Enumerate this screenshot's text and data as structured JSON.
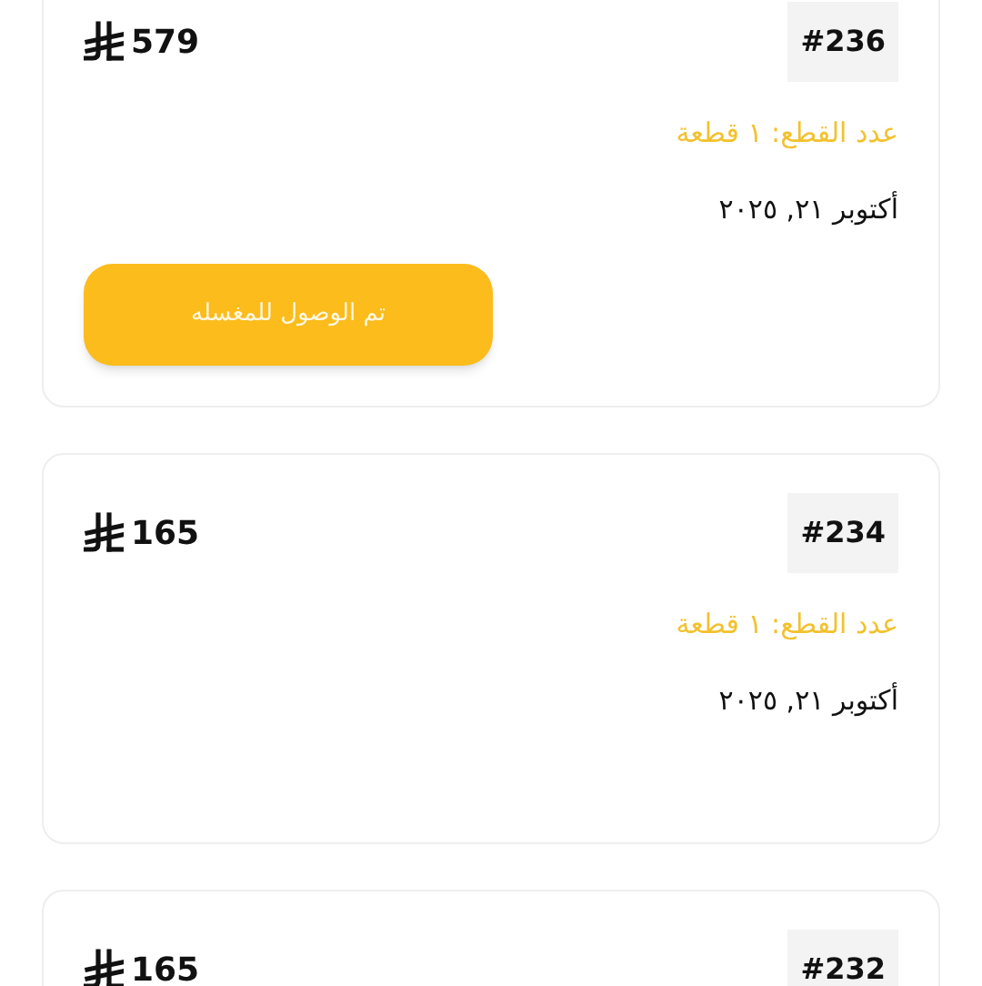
{
  "orders": [
    {
      "number": "#236",
      "price": "579",
      "quantity": "عدد القطع: ١ قطعة",
      "date": "أكتوبر ٢١, ٢٠٢٥",
      "action": "تم الوصول للمغسله"
    },
    {
      "number": "#234",
      "price": "165",
      "quantity": "عدد القطع: ١ قطعة",
      "date": "أكتوبر ٢١, ٢٠٢٥"
    },
    {
      "number": "#232",
      "price": "165"
    }
  ]
}
